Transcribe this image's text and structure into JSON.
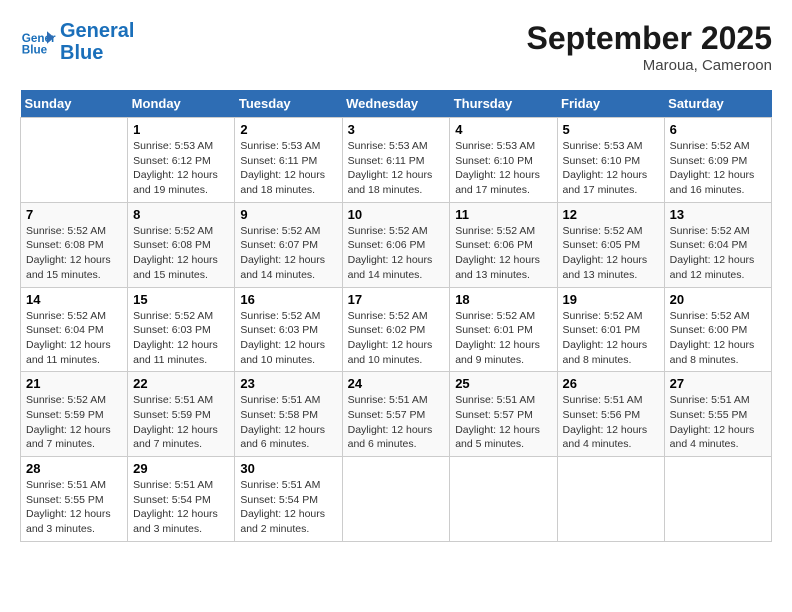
{
  "logo": {
    "line1": "General",
    "line2": "Blue"
  },
  "title": "September 2025",
  "location": "Maroua, Cameroon",
  "headers": [
    "Sunday",
    "Monday",
    "Tuesday",
    "Wednesday",
    "Thursday",
    "Friday",
    "Saturday"
  ],
  "weeks": [
    [
      {
        "day": "",
        "info": ""
      },
      {
        "day": "1",
        "info": "Sunrise: 5:53 AM\nSunset: 6:12 PM\nDaylight: 12 hours\nand 19 minutes."
      },
      {
        "day": "2",
        "info": "Sunrise: 5:53 AM\nSunset: 6:11 PM\nDaylight: 12 hours\nand 18 minutes."
      },
      {
        "day": "3",
        "info": "Sunrise: 5:53 AM\nSunset: 6:11 PM\nDaylight: 12 hours\nand 18 minutes."
      },
      {
        "day": "4",
        "info": "Sunrise: 5:53 AM\nSunset: 6:10 PM\nDaylight: 12 hours\nand 17 minutes."
      },
      {
        "day": "5",
        "info": "Sunrise: 5:53 AM\nSunset: 6:10 PM\nDaylight: 12 hours\nand 17 minutes."
      },
      {
        "day": "6",
        "info": "Sunrise: 5:52 AM\nSunset: 6:09 PM\nDaylight: 12 hours\nand 16 minutes."
      }
    ],
    [
      {
        "day": "7",
        "info": "Sunrise: 5:52 AM\nSunset: 6:08 PM\nDaylight: 12 hours\nand 15 minutes."
      },
      {
        "day": "8",
        "info": "Sunrise: 5:52 AM\nSunset: 6:08 PM\nDaylight: 12 hours\nand 15 minutes."
      },
      {
        "day": "9",
        "info": "Sunrise: 5:52 AM\nSunset: 6:07 PM\nDaylight: 12 hours\nand 14 minutes."
      },
      {
        "day": "10",
        "info": "Sunrise: 5:52 AM\nSunset: 6:06 PM\nDaylight: 12 hours\nand 14 minutes."
      },
      {
        "day": "11",
        "info": "Sunrise: 5:52 AM\nSunset: 6:06 PM\nDaylight: 12 hours\nand 13 minutes."
      },
      {
        "day": "12",
        "info": "Sunrise: 5:52 AM\nSunset: 6:05 PM\nDaylight: 12 hours\nand 13 minutes."
      },
      {
        "day": "13",
        "info": "Sunrise: 5:52 AM\nSunset: 6:04 PM\nDaylight: 12 hours\nand 12 minutes."
      }
    ],
    [
      {
        "day": "14",
        "info": "Sunrise: 5:52 AM\nSunset: 6:04 PM\nDaylight: 12 hours\nand 11 minutes."
      },
      {
        "day": "15",
        "info": "Sunrise: 5:52 AM\nSunset: 6:03 PM\nDaylight: 12 hours\nand 11 minutes."
      },
      {
        "day": "16",
        "info": "Sunrise: 5:52 AM\nSunset: 6:03 PM\nDaylight: 12 hours\nand 10 minutes."
      },
      {
        "day": "17",
        "info": "Sunrise: 5:52 AM\nSunset: 6:02 PM\nDaylight: 12 hours\nand 10 minutes."
      },
      {
        "day": "18",
        "info": "Sunrise: 5:52 AM\nSunset: 6:01 PM\nDaylight: 12 hours\nand 9 minutes."
      },
      {
        "day": "19",
        "info": "Sunrise: 5:52 AM\nSunset: 6:01 PM\nDaylight: 12 hours\nand 8 minutes."
      },
      {
        "day": "20",
        "info": "Sunrise: 5:52 AM\nSunset: 6:00 PM\nDaylight: 12 hours\nand 8 minutes."
      }
    ],
    [
      {
        "day": "21",
        "info": "Sunrise: 5:52 AM\nSunset: 5:59 PM\nDaylight: 12 hours\nand 7 minutes."
      },
      {
        "day": "22",
        "info": "Sunrise: 5:51 AM\nSunset: 5:59 PM\nDaylight: 12 hours\nand 7 minutes."
      },
      {
        "day": "23",
        "info": "Sunrise: 5:51 AM\nSunset: 5:58 PM\nDaylight: 12 hours\nand 6 minutes."
      },
      {
        "day": "24",
        "info": "Sunrise: 5:51 AM\nSunset: 5:57 PM\nDaylight: 12 hours\nand 6 minutes."
      },
      {
        "day": "25",
        "info": "Sunrise: 5:51 AM\nSunset: 5:57 PM\nDaylight: 12 hours\nand 5 minutes."
      },
      {
        "day": "26",
        "info": "Sunrise: 5:51 AM\nSunset: 5:56 PM\nDaylight: 12 hours\nand 4 minutes."
      },
      {
        "day": "27",
        "info": "Sunrise: 5:51 AM\nSunset: 5:55 PM\nDaylight: 12 hours\nand 4 minutes."
      }
    ],
    [
      {
        "day": "28",
        "info": "Sunrise: 5:51 AM\nSunset: 5:55 PM\nDaylight: 12 hours\nand 3 minutes."
      },
      {
        "day": "29",
        "info": "Sunrise: 5:51 AM\nSunset: 5:54 PM\nDaylight: 12 hours\nand 3 minutes."
      },
      {
        "day": "30",
        "info": "Sunrise: 5:51 AM\nSunset: 5:54 PM\nDaylight: 12 hours\nand 2 minutes."
      },
      {
        "day": "",
        "info": ""
      },
      {
        "day": "",
        "info": ""
      },
      {
        "day": "",
        "info": ""
      },
      {
        "day": "",
        "info": ""
      }
    ]
  ]
}
